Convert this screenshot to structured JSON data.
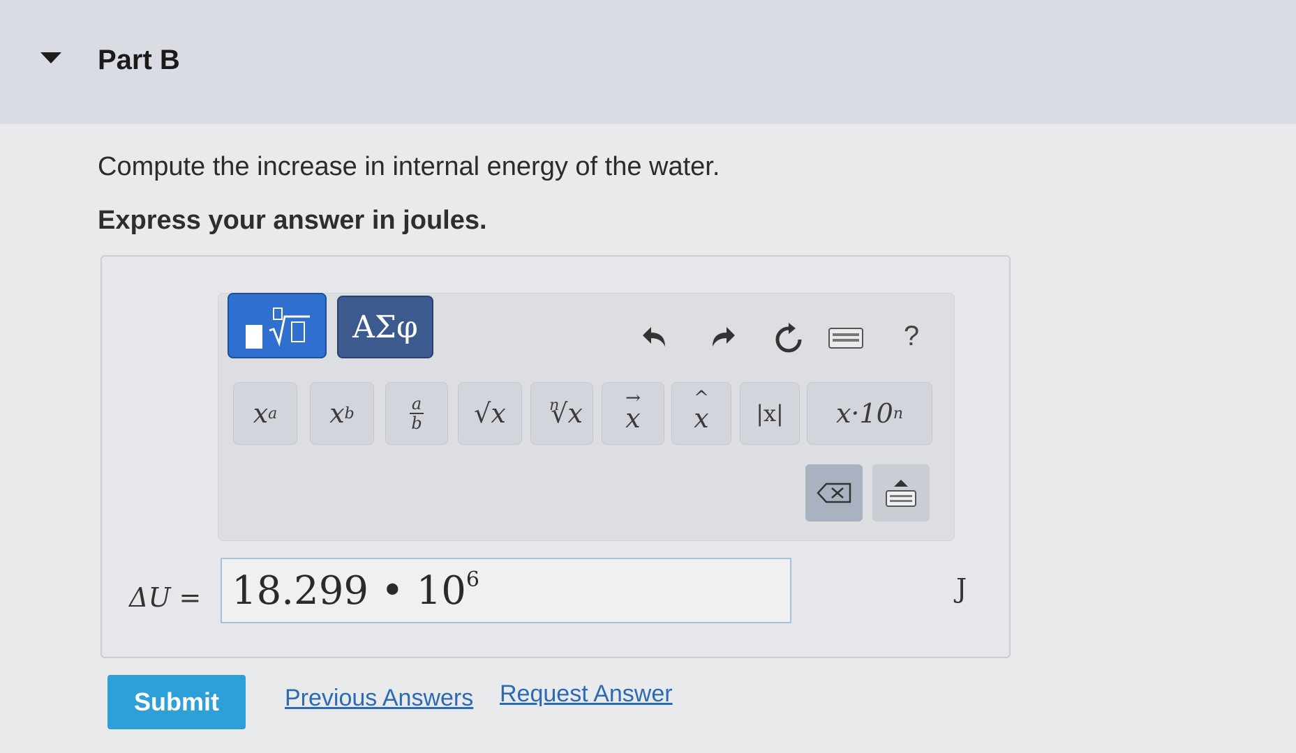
{
  "part": {
    "title": "Part B"
  },
  "question": {
    "text": "Compute the increase in internal energy of the water.",
    "instruction": "Express your answer in joules."
  },
  "toolbar": {
    "greek_label": "ΑΣφ",
    "help_label": "?",
    "keys": [
      {
        "name": "superscript",
        "label": "x",
        "sup": "a"
      },
      {
        "name": "subscript",
        "label": "x",
        "sub": "b"
      },
      {
        "name": "fraction",
        "num": "a",
        "den": "b"
      },
      {
        "name": "square-root",
        "label": "√x"
      },
      {
        "name": "nth-root",
        "label": "√x",
        "index": "n"
      },
      {
        "name": "vector",
        "label": "x"
      },
      {
        "name": "unit-vector",
        "label": "x"
      },
      {
        "name": "absolute-value",
        "label": "|x|"
      },
      {
        "name": "scientific-notation",
        "label": "x·10",
        "sup": "n"
      }
    ],
    "icons": [
      "template-icon",
      "undo-icon",
      "redo-icon",
      "reset-icon",
      "keyboard-icon",
      "backspace-icon"
    ]
  },
  "answer": {
    "variable": "ΔU =",
    "value_mantissa": "18.299 • 10",
    "value_exponent": "6",
    "unit": "J"
  },
  "actions": {
    "submit_label": "Submit",
    "previous_answers_label": "Previous Answers",
    "request_answer_label": "Request Answer"
  },
  "colors": {
    "template_button": "#2f6fd0",
    "greek_button": "#3d5a8e",
    "submit_button": "#2e9fd7",
    "link": "#2c6ab4"
  }
}
